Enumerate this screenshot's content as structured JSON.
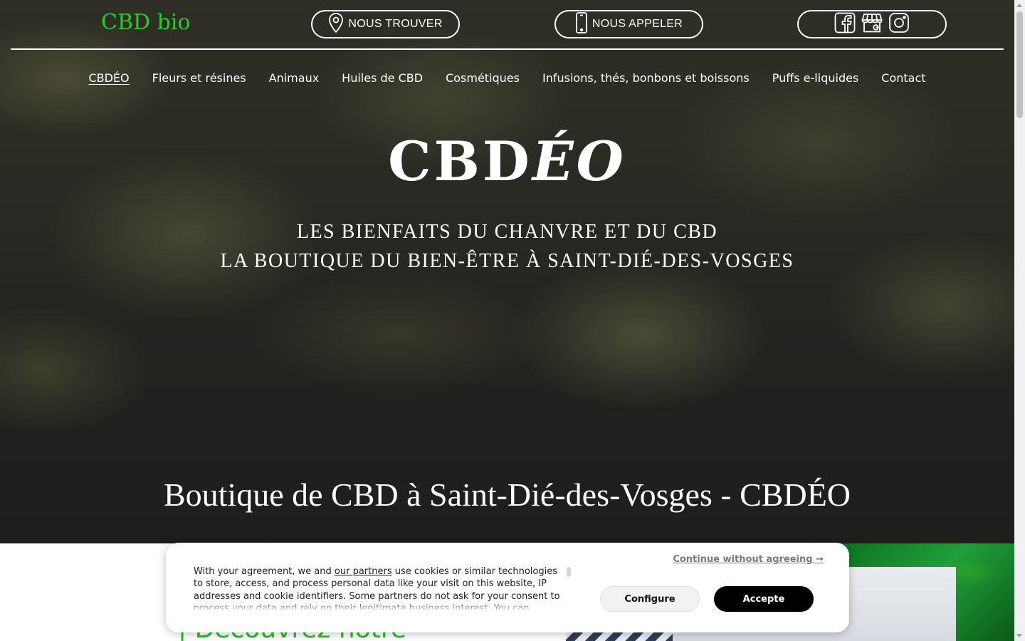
{
  "header": {
    "brand": "CBD bio",
    "find_label": "NOUS TROUVER",
    "call_label": "NOUS APPELER",
    "social_icons": [
      "facebook-icon",
      "store-icon",
      "instagram-icon"
    ]
  },
  "nav": {
    "items": [
      {
        "label": "CBDÉO",
        "active": true
      },
      {
        "label": "Fleurs et résines"
      },
      {
        "label": "Animaux"
      },
      {
        "label": "Huiles de CBD"
      },
      {
        "label": "Cosmétiques"
      },
      {
        "label": "Infusions, thés, bonbons et boissons"
      },
      {
        "label": "Puffs e-liquides"
      },
      {
        "label": "Contact"
      }
    ]
  },
  "hero": {
    "logo_main": "CBD",
    "logo_italic": "ÉO",
    "tagline_line1": "LES BIENFAITS DU CHANVRE ET DU CBD",
    "tagline_line2": "LA BOUTIQUE DU BIEN-ÊTRE À SAINT-DIÉ-DES-VOSGES",
    "title": "Boutique de CBD à Saint-Dié-des-Vosges - CBDÉO"
  },
  "section": {
    "heading": "| Découvrez notre"
  },
  "cookie": {
    "text_before_link": "With your agreement, we and ",
    "link": "our partners",
    "text_after_link": " use cookies or similar technologies to store, access, and process personal data like your visit on this website, IP addresses and cookie identifiers. Some partners do not ask for your consent to process your data and rely on their legitimate business interest. You can",
    "continue": "Continue without agreeing →",
    "configure": "Configure",
    "accept": "Accepte"
  },
  "colors": {
    "brand_green": "#22d022",
    "heading_green": "#22c022",
    "accept_bg": "#000000"
  }
}
